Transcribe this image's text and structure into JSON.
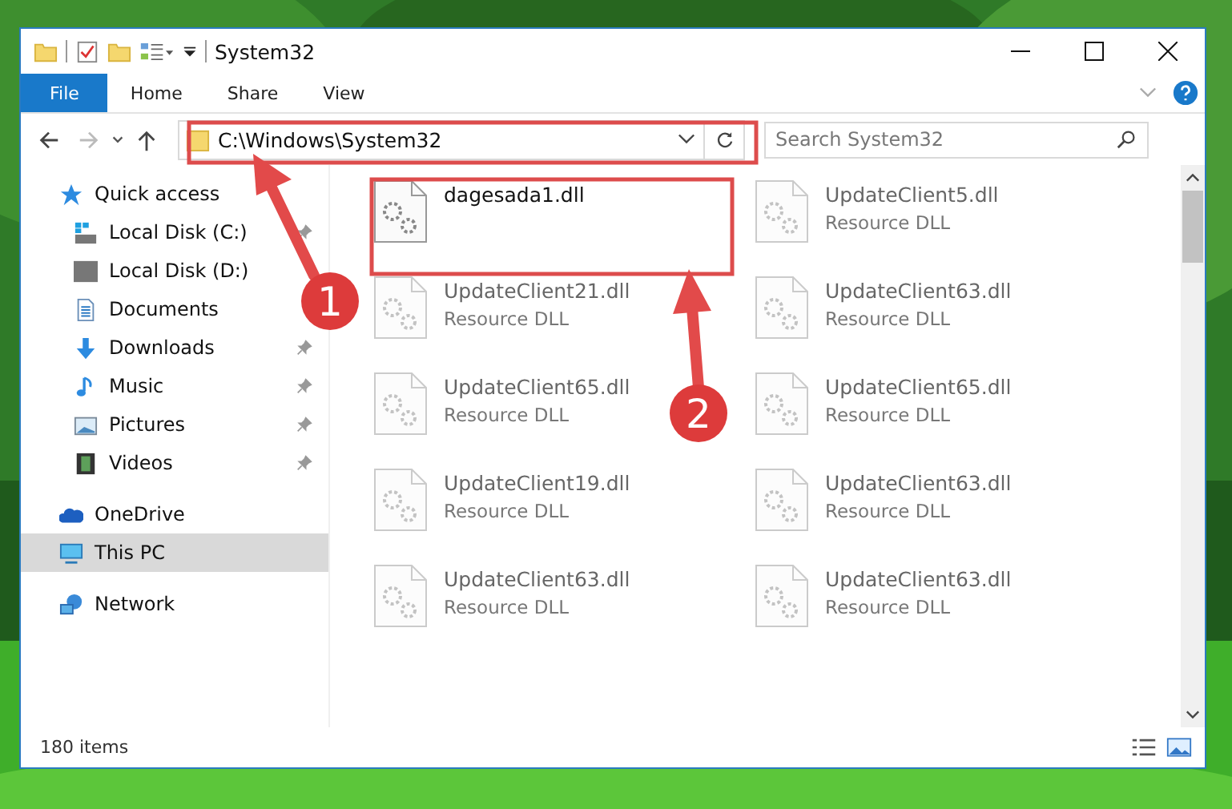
{
  "window": {
    "title": "System32"
  },
  "ribbon_tabs": [
    {
      "label": "File",
      "selected": true
    },
    {
      "label": "Home",
      "selected": false
    },
    {
      "label": "Share",
      "selected": false
    },
    {
      "label": "View",
      "selected": false
    }
  ],
  "address": {
    "path": "C:\\Windows\\System32"
  },
  "search": {
    "placeholder": "Search System32"
  },
  "sidebar": {
    "items": [
      {
        "label": "Quick access",
        "selected": false,
        "children": [
          {
            "label": "Local Disk (C:)",
            "pinned": true
          },
          {
            "label": "Local Disk (D:)",
            "pinned": false
          },
          {
            "label": "Documents",
            "pinned": false
          },
          {
            "label": "Downloads",
            "pinned": true
          },
          {
            "label": "Music",
            "pinned": true
          },
          {
            "label": "Pictures",
            "pinned": true
          },
          {
            "label": "Videos",
            "pinned": true
          }
        ]
      },
      {
        "label": "OneDrive",
        "selected": false
      },
      {
        "label": "This PC",
        "selected": true
      },
      {
        "label": "Network",
        "selected": false
      }
    ]
  },
  "files": [
    {
      "name": "dagesada1.dll",
      "dimmed": false
    },
    {
      "name": "UpdateClient5.dll",
      "type": "Resource DLL",
      "dimmed": true
    },
    {
      "name": "UpdateClient21.dll",
      "type": "Resource DLL",
      "dimmed": true
    },
    {
      "name": "UpdateClient63.dll",
      "type": "Resource DLL",
      "dimmed": true
    },
    {
      "name": "UpdateClient65.dll",
      "type": "Resource DLL",
      "dimmed": true
    },
    {
      "name": "UpdateClient65.dll",
      "type": "Resource DLL",
      "dimmed": true
    },
    {
      "name": "UpdateClient19.dll",
      "type": "Resource DLL",
      "dimmed": true
    },
    {
      "name": "UpdateClient63.dll",
      "type": "Resource DLL",
      "dimmed": true
    },
    {
      "name": "UpdateClient63.dll",
      "type": "Resource DLL",
      "dimmed": true
    },
    {
      "name": "UpdateClient63.dll",
      "type": "Resource DLL",
      "dimmed": true
    }
  ],
  "status_bar": {
    "item_count": "180 items"
  },
  "annotations": [
    {
      "label": "1"
    },
    {
      "label": "2"
    }
  ]
}
